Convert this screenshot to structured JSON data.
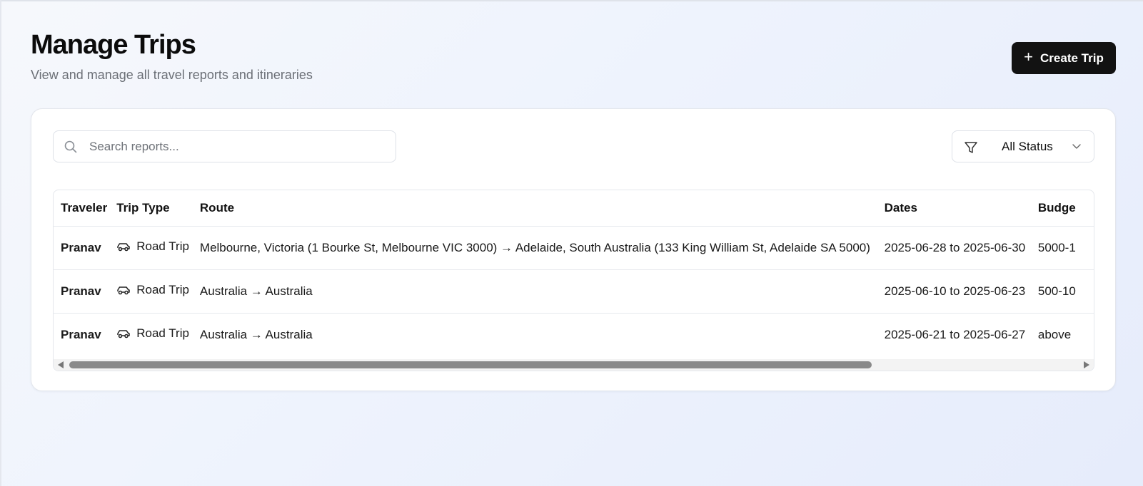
{
  "header": {
    "title": "Manage Trips",
    "subtitle": "View and manage all travel reports and itineraries",
    "create_button_label": "Create Trip"
  },
  "filters": {
    "search_placeholder": "Search reports...",
    "status_selected": "All Status"
  },
  "table": {
    "columns": [
      "Traveler",
      "Trip Type",
      "Route",
      "Dates",
      "Budge"
    ],
    "rows": [
      {
        "traveler": "Pranav",
        "trip_type": "Road Trip",
        "trip_type_icon": "car-icon",
        "route": "Melbourne, Victoria (1 Bourke St, Melbourne VIC 3000) → Adelaide, South Australia (133 King William St, Adelaide SA 5000)",
        "dates": "2025-06-28 to 2025-06-30",
        "budget": "5000-1"
      },
      {
        "traveler": "Pranav",
        "trip_type": "Road Trip",
        "trip_type_icon": "car-icon",
        "route": "Australia → Australia",
        "dates": "2025-06-10 to 2025-06-23",
        "budget": "500-10"
      },
      {
        "traveler": "Pranav",
        "trip_type": "Road Trip",
        "trip_type_icon": "car-icon",
        "route": "Australia → Australia",
        "dates": "2025-06-21 to 2025-06-27",
        "budget": "above"
      }
    ]
  },
  "colors": {
    "primary_button_bg": "#121212",
    "scroll_thumb": "#8a8a8a"
  }
}
